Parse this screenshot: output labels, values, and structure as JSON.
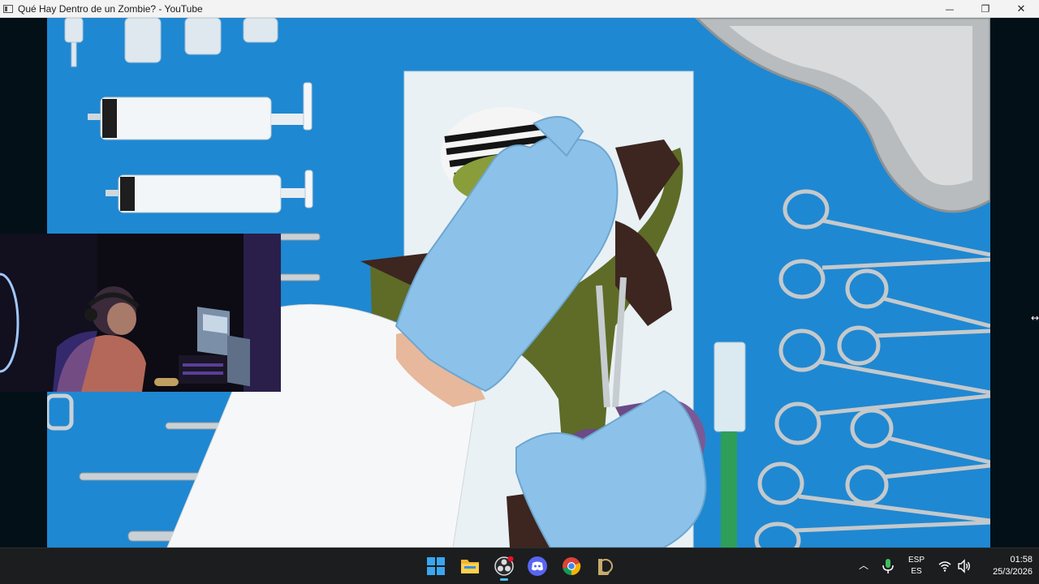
{
  "window": {
    "title": "Qué Hay Dentro de un Zombie? - YouTube",
    "minimize_glyph": "—",
    "maximize_glyph": "❐",
    "close_glyph": "✕"
  },
  "video": {
    "frame_icons": [
      "syringe-icon",
      "scissors-icon",
      "forceps-icon",
      "kidney-dish-icon",
      "scalpel-icon"
    ]
  },
  "webcam": {
    "icon": "webcam-overlay"
  },
  "taskbar": {
    "items": [
      {
        "name": "start-button",
        "icon": "windows-logo-icon"
      },
      {
        "name": "file-explorer-button",
        "icon": "folder-icon"
      },
      {
        "name": "obs-button",
        "icon": "obs-icon",
        "active": true
      },
      {
        "name": "discord-button",
        "icon": "discord-icon"
      },
      {
        "name": "chrome-button",
        "icon": "chrome-icon"
      },
      {
        "name": "league-client-button",
        "icon": "league-icon"
      }
    ],
    "tray": {
      "chevron": "︿",
      "lang_top": "ESP",
      "lang_bottom": "ES",
      "time": "01:58",
      "date": "25/3/2026"
    }
  },
  "colors": {
    "accent": "#4cc2ff",
    "taskbar_bg": "#1c1d1f",
    "drape_blue": "#1e86cf",
    "glove_blue": "#8cc2ea"
  }
}
